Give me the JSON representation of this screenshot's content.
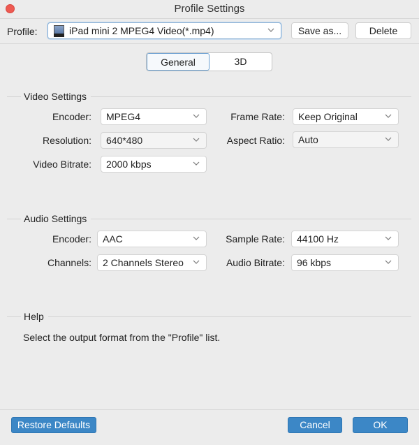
{
  "window": {
    "title": "Profile Settings"
  },
  "profile": {
    "label": "Profile:",
    "value": "iPad mini 2 MPEG4 Video(*.mp4)",
    "icon": "ipad-icon",
    "save_as_label": "Save as...",
    "delete_label": "Delete"
  },
  "tabs": [
    {
      "label": "General",
      "selected": true
    },
    {
      "label": "3D",
      "selected": false
    }
  ],
  "video": {
    "title": "Video Settings",
    "encoder_label": "Encoder:",
    "encoder_value": "MPEG4",
    "resolution_label": "Resolution:",
    "resolution_value": "640*480",
    "bitrate_label": "Video Bitrate:",
    "bitrate_value": "2000 kbps",
    "frame_rate_label": "Frame Rate:",
    "frame_rate_value": "Keep Original",
    "aspect_label": "Aspect Ratio:",
    "aspect_value": "Auto"
  },
  "audio": {
    "title": "Audio Settings",
    "encoder_label": "Encoder:",
    "encoder_value": "AAC",
    "channels_label": "Channels:",
    "channels_value": "2 Channels Stereo",
    "sample_rate_label": "Sample Rate:",
    "sample_rate_value": "44100 Hz",
    "bitrate_label": "Audio Bitrate:",
    "bitrate_value": "96 kbps"
  },
  "help": {
    "title": "Help",
    "text": "Select the output format from the \"Profile\" list."
  },
  "footer": {
    "restore_label": "Restore Defaults",
    "cancel_label": "Cancel",
    "ok_label": "OK"
  },
  "colors": {
    "accent": "#3c87c6",
    "close": "#ee5a52"
  }
}
